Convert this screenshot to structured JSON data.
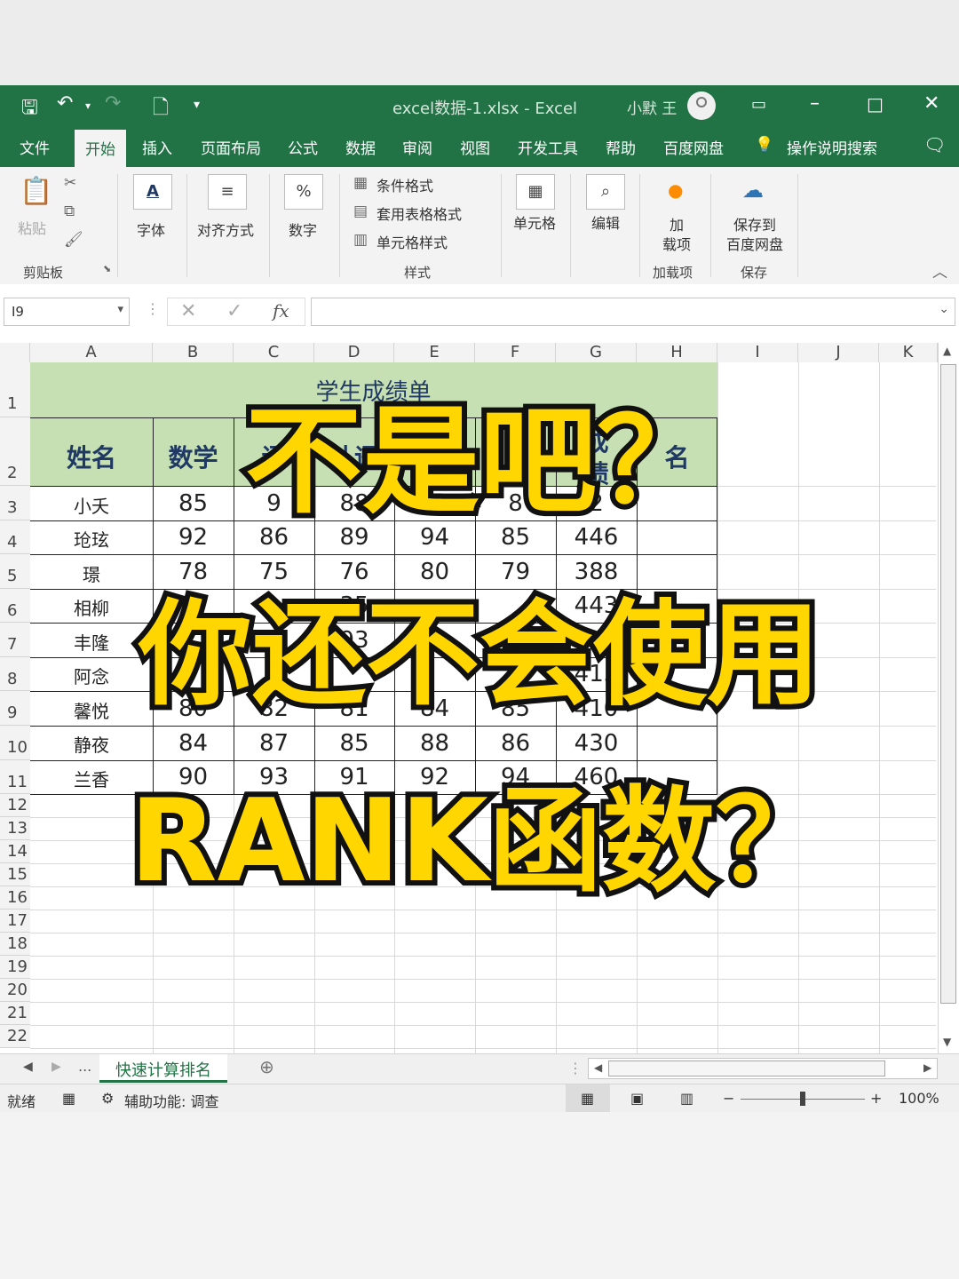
{
  "window": {
    "document_title": "excel数据-1.xlsx  -  Excel",
    "user": "小默 王"
  },
  "tabs": [
    "文件",
    "开始",
    "插入",
    "页面布局",
    "公式",
    "数据",
    "审阅",
    "视图",
    "开发工具",
    "帮助",
    "百度网盘"
  ],
  "tell_me": "操作说明搜索",
  "ribbon": {
    "paste": "粘贴",
    "clipboard_group": "剪贴板",
    "font": "字体",
    "alignment": "对齐方式",
    "number": "数字",
    "conditional_format": "条件格式",
    "table_format": "套用表格格式",
    "cell_styles": "单元格样式",
    "styles_group": "样式",
    "cells": "单元格",
    "editing": "编辑",
    "addins_line1": "加",
    "addins_line2": "载项",
    "addins_group": "加载项",
    "save_baidu_line1": "保存到",
    "save_baidu_line2": "百度网盘",
    "save_group": "保存"
  },
  "formula_bar": {
    "name_box": "I9",
    "fx": "fx",
    "value": ""
  },
  "columns": [
    "A",
    "B",
    "C",
    "D",
    "E",
    "F",
    "G",
    "H",
    "I",
    "J",
    "K"
  ],
  "rows": [
    "1",
    "2",
    "3",
    "4",
    "5",
    "6",
    "7",
    "8",
    "9",
    "10",
    "11",
    "12",
    "13",
    "14",
    "15",
    "16",
    "17",
    "18",
    "19",
    "20",
    "21",
    "22"
  ],
  "sheet": {
    "title": "学生成绩单",
    "headers": {
      "name": "姓名",
      "math": "数学",
      "c_partial": "语",
      "english_partial": "外语",
      "total_partial_top": "成",
      "total_partial_bottom": "绩",
      "rank_partial": "名"
    },
    "names": [
      "小夭",
      "玱玹",
      "璟",
      "相柳",
      "丰隆",
      "阿念",
      "馨悦",
      "静夜",
      "兰香"
    ],
    "row3": [
      "85",
      "9",
      "88",
      "8",
      "4",
      "2"
    ],
    "row4": [
      "92",
      "86",
      "89",
      "94",
      "85",
      "446"
    ],
    "row5": [
      "78",
      "75",
      "76",
      "80",
      "79",
      "388"
    ],
    "row6": [
      "8",
      "35",
      "8",
      "443"
    ],
    "row7": [
      "93",
      "8"
    ],
    "row8": [
      "9",
      "415"
    ],
    "row9": [
      "80",
      "82",
      "81",
      "84",
      "85",
      "410"
    ],
    "row10": [
      "84",
      "87",
      "85",
      "88",
      "86",
      "430"
    ],
    "row11": [
      "90",
      "93",
      "91",
      "92",
      "94",
      "460"
    ]
  },
  "sheet_tabs": {
    "active": "快速计算排名",
    "more": "..."
  },
  "status": {
    "ready": "就绪",
    "accessibility": "辅助功能: 调查",
    "zoom": "100%"
  },
  "overlay": {
    "line1": "不是吧？",
    "line2": "你还不会使用",
    "line3": "RANK函数？"
  },
  "colors": {
    "excel_green": "#217346",
    "header_fill": "#c6e0b4",
    "overlay_yellow": "#ffd600",
    "overlay_outline": "#111111"
  }
}
